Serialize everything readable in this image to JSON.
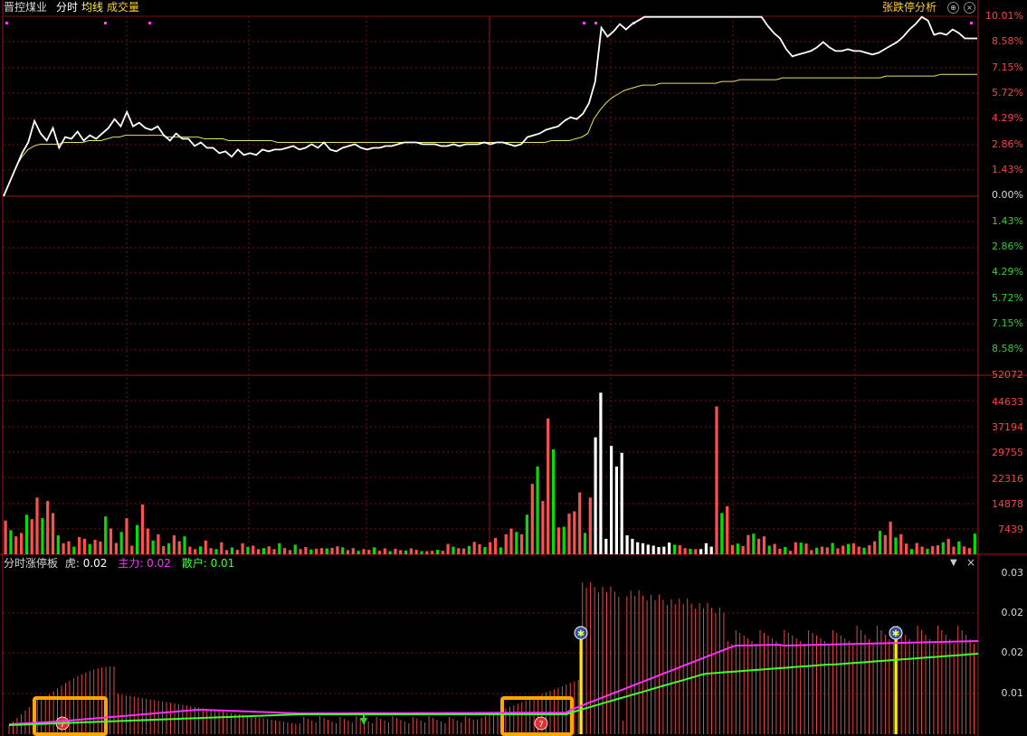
{
  "header": {
    "stock_name": "晋控煤业",
    "tab_intraday": "分时",
    "tab_avg": "均线",
    "tab_volume": "成交量",
    "limit_analysis": "张跌停分析"
  },
  "price_axis": {
    "labels_up": [
      "10.01%",
      "8.58%",
      "7.15%",
      "5.72%",
      "4.29%",
      "2.86%",
      "1.43%",
      "0.00%"
    ],
    "labels_down": [
      "1.43%",
      "2.86%",
      "4.29%",
      "5.72%",
      "7.15%",
      "8.58%"
    ]
  },
  "volume_axis": {
    "labels": [
      "52072",
      "44633",
      "37194",
      "29755",
      "22316",
      "14878",
      "7439"
    ]
  },
  "indicator": {
    "title": "分时涨停板",
    "hu_label": "虎:",
    "hu_value": "0.02",
    "zhuli_label": "主力:",
    "zhuli_value": "0.02",
    "sanhu_label": "散户:",
    "sanhu_value": "0.01",
    "axis_labels": [
      "0.03",
      "0.02",
      "0.02",
      "0.01"
    ]
  },
  "colors": {
    "up": "#ff5050",
    "down": "#00e000",
    "grid": "#7a1010",
    "price_line": "#ffffff",
    "avg_line": "#e8e060",
    "zhuli_line": "#ff30ff",
    "sanhu_line": "#40ff30",
    "highlight_box": "#ffa500",
    "marker_line": "#ffee00"
  },
  "chart_data": {
    "type": "line",
    "title": "",
    "price_pct": [
      0.0,
      0.8,
      1.6,
      2.4,
      3.0,
      4.2,
      3.5,
      3.1,
      3.8,
      2.7,
      3.3,
      3.2,
      3.6,
      3.1,
      3.4,
      3.2,
      3.5,
      3.8,
      4.3,
      3.9,
      4.7,
      3.9,
      4.1,
      3.8,
      3.7,
      3.9,
      3.4,
      3.1,
      3.5,
      3.2,
      3.2,
      2.8,
      3.0,
      2.7,
      2.7,
      2.4,
      2.5,
      2.2,
      2.6,
      2.3,
      2.4,
      2.3,
      2.6,
      2.5,
      2.6,
      2.6,
      2.7,
      2.8,
      2.6,
      2.7,
      2.9,
      2.7,
      3.0,
      2.6,
      2.5,
      2.7,
      2.8,
      2.9,
      2.7,
      2.6,
      2.7,
      2.7,
      2.8,
      2.8,
      2.9,
      3.0,
      3.0,
      3.0,
      2.9,
      2.9,
      2.9,
      2.8,
      2.8,
      2.9,
      2.8,
      2.9,
      2.9,
      2.9,
      3.0,
      2.9,
      3.0,
      3.0,
      2.9,
      2.8,
      2.9,
      3.3,
      3.4,
      3.5,
      3.7,
      3.8,
      3.9,
      4.2,
      4.4,
      4.3,
      4.6,
      5.2,
      6.4,
      9.4,
      8.9,
      9.2,
      9.6,
      9.3,
      9.6,
      9.8,
      10.0,
      10.0,
      10.0,
      10.0,
      10.0,
      10.0,
      10.0,
      10.0,
      10.0,
      10.0,
      10.0,
      10.0,
      10.0,
      10.0,
      10.0,
      10.0,
      10.0,
      10.0,
      10.0,
      10.0,
      9.5,
      9.1,
      8.8,
      8.2,
      7.8,
      7.9,
      8.0,
      8.1,
      8.3,
      8.6,
      8.3,
      8.1,
      8.1,
      8.2,
      8.1,
      8.1,
      8.0,
      7.9,
      8.0,
      8.2,
      8.4,
      8.6,
      8.9,
      9.3,
      9.6,
      10.0,
      9.8,
      9.0,
      9.1,
      9.0,
      9.3,
      9.1,
      8.8,
      8.8,
      8.8
    ],
    "avg_pct": [
      0.0,
      0.8,
      1.6,
      2.2,
      2.6,
      2.8,
      2.9,
      2.9,
      2.9,
      2.9,
      3.0,
      3.0,
      3.0,
      3.0,
      3.1,
      3.1,
      3.1,
      3.2,
      3.3,
      3.3,
      3.4,
      3.4,
      3.4,
      3.4,
      3.4,
      3.4,
      3.4,
      3.3,
      3.3,
      3.3,
      3.3,
      3.3,
      3.3,
      3.2,
      3.2,
      3.2,
      3.2,
      3.1,
      3.1,
      3.1,
      3.1,
      3.1,
      3.1,
      3.1,
      3.1,
      3.0,
      3.0,
      3.0,
      3.0,
      3.0,
      3.0,
      3.0,
      3.0,
      3.0,
      3.0,
      3.0,
      3.0,
      3.0,
      3.0,
      3.0,
      3.0,
      3.0,
      3.0,
      3.0,
      3.0,
      3.0,
      3.0,
      3.0,
      3.0,
      3.0,
      3.0,
      3.0,
      3.0,
      3.0,
      3.0,
      3.0,
      3.0,
      3.0,
      3.0,
      3.0,
      3.0,
      3.0,
      3.0,
      3.0,
      3.0,
      3.0,
      3.0,
      3.0,
      3.0,
      3.0,
      3.1,
      3.1,
      3.1,
      3.1,
      3.2,
      3.3,
      3.5,
      4.3,
      4.8,
      5.2,
      5.5,
      5.7,
      5.9,
      6.0,
      6.1,
      6.2,
      6.2,
      6.2,
      6.3,
      6.3,
      6.3,
      6.3,
      6.3,
      6.3,
      6.3,
      6.3,
      6.3,
      6.3,
      6.4,
      6.4,
      6.4,
      6.5,
      6.5,
      6.5,
      6.5,
      6.5,
      6.5,
      6.5,
      6.6,
      6.6,
      6.6,
      6.6,
      6.6,
      6.6,
      6.6,
      6.6,
      6.6,
      6.6,
      6.6,
      6.6,
      6.6,
      6.6,
      6.6,
      6.6,
      6.6,
      6.7,
      6.7,
      6.7,
      6.7,
      6.7,
      6.7,
      6.7,
      6.7,
      6.7,
      6.8,
      6.8,
      6.8,
      6.8,
      6.8,
      6.8,
      6.8
    ],
    "volume": [
      9800,
      7000,
      5200,
      6200,
      11500,
      10200,
      16500,
      10500,
      15500,
      12000,
      5500,
      3200,
      3800,
      2200,
      5000,
      4500,
      3000,
      4200,
      3700,
      11000,
      7500,
      3300,
      6500,
      10500,
      2500,
      8500,
      14500,
      7500,
      4000,
      5800,
      2400,
      3200,
      5500,
      3800,
      5200,
      2200,
      1500,
      2300,
      4000,
      1800,
      1500,
      3500,
      1200,
      2000,
      1300,
      3200,
      2100,
      2500,
      1500,
      1800,
      2300,
      1500,
      3200,
      1800,
      1200,
      2800,
      1500,
      2100,
      1400,
      1600,
      1800,
      1700,
      1900,
      2300,
      2000,
      1200,
      1800,
      1000,
      1500,
      1300,
      2000,
      1000,
      1700,
      900,
      1600,
      1200,
      1100,
      1700,
      1300,
      900,
      900,
      1000,
      1300,
      1000,
      3000,
      2200,
      1800,
      1700,
      2400,
      3600,
      2900,
      2100,
      3500,
      4700,
      2000,
      5800,
      7500,
      6500,
      5800,
      11500,
      20500,
      25500,
      15500,
      39500,
      30500,
      7800,
      8000,
      11800,
      12500,
      18000,
      6200,
      16500,
      34000,
      47000,
      4500,
      31500,
      25500,
      29500,
      5500,
      4500,
      3500,
      3200,
      2800,
      2500,
      2100,
      2200,
      3400,
      2800,
      2600,
      1800,
      1600,
      1500,
      1500,
      3200,
      2200,
      43000,
      12000,
      14000,
      2700,
      3100,
      2400,
      5600,
      6000,
      4500,
      5200,
      2500,
      3000,
      1600,
      2100,
      1000,
      3500,
      3400,
      3100,
      1200,
      1900,
      2200,
      2000,
      3300,
      1700,
      2500,
      3000,
      3200,
      2200,
      1900,
      2600,
      3800,
      6800,
      5600,
      9500,
      4900,
      5800,
      3100,
      1500,
      3300,
      2200,
      1600,
      2400,
      2600,
      3500,
      4500,
      2200,
      3700,
      2300,
      1800,
      6000
    ]
  }
}
